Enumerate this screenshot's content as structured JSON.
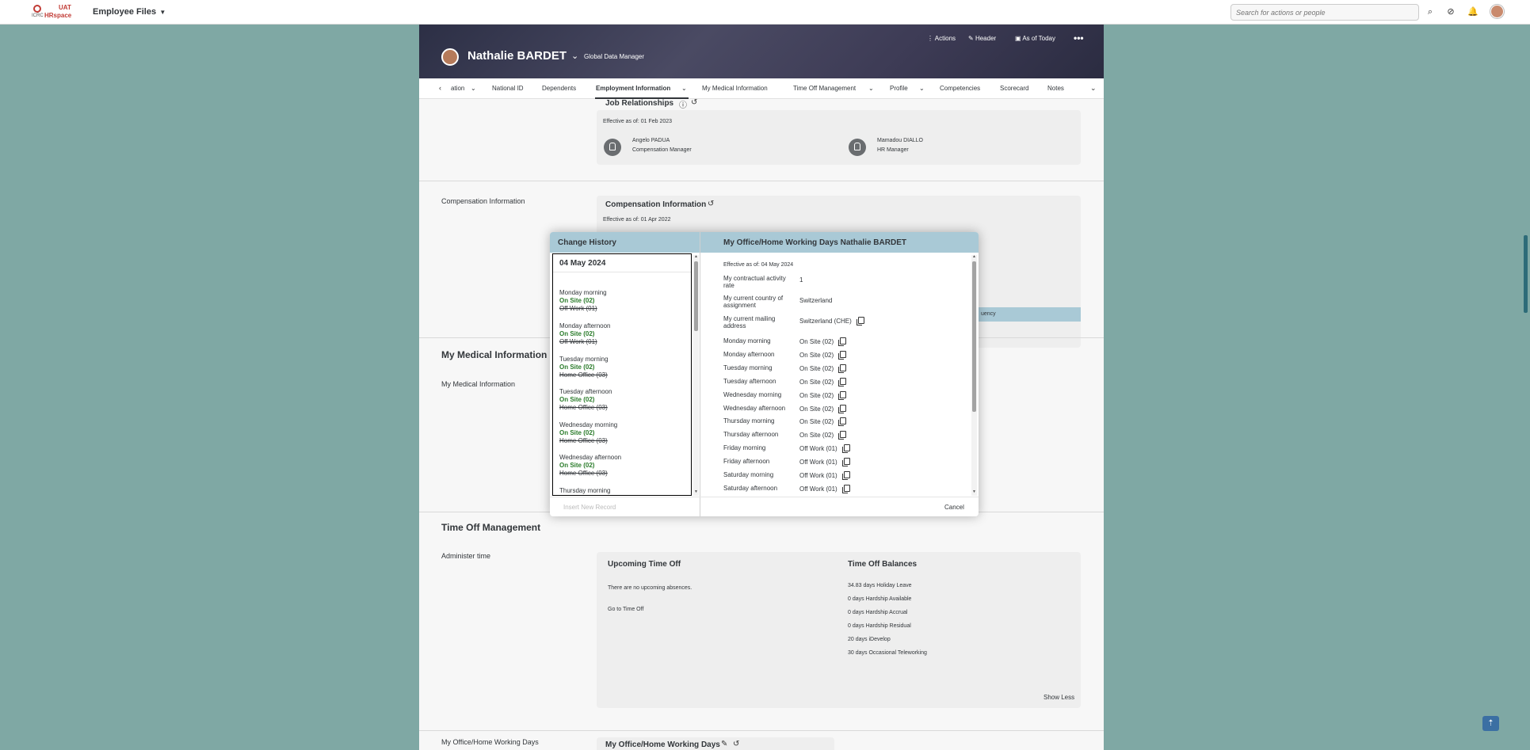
{
  "shell": {
    "logo_env": "UAT",
    "logo_small": "ICRC",
    "logo_app": "HRspace",
    "app_menu": "Employee Files",
    "search_placeholder": "Search for actions or people"
  },
  "header": {
    "name": "Nathalie BARDET",
    "job_title": "Global Data Manager",
    "actions_label": "Actions",
    "header_label": "Header",
    "as_of_label": "As of Today"
  },
  "tabs": [
    "ation",
    "National ID",
    "Dependents",
    "Employment Information",
    "My Medical Information",
    "Time Off Management",
    "Profile",
    "Competencies",
    "Scorecard",
    "Notes"
  ],
  "job_relationships": {
    "section_label": "Job Relationships",
    "card_title": "Job Relationships",
    "effective": "Effective as of: 01 Feb 2023",
    "people": [
      {
        "name": "Angelo PADUA",
        "role": "Compensation Manager"
      },
      {
        "name": "Mamadou DIALLO",
        "role": "HR Manager"
      }
    ]
  },
  "compensation": {
    "section_label": "Compensation Information",
    "card_title": "Compensation Information",
    "effective": "Effective as of: 01 Apr 2022",
    "partial_column": "uency"
  },
  "medical": {
    "section_title": "My Medical Information",
    "section_label": "My Medical Information"
  },
  "time_off": {
    "section_title": "Time Off Management",
    "section_label": "Administer time",
    "upcoming_title": "Upcoming Time Off",
    "no_absences": "There are no upcoming absences.",
    "go_link": "Go to Time Off",
    "balances_title": "Time Off Balances",
    "balances": [
      {
        "amount": "34.83 days",
        "type": "Holiday Leave"
      },
      {
        "amount": "0 days",
        "type": "Hardship Available"
      },
      {
        "amount": "0 days",
        "type": "Hardship Accrual"
      },
      {
        "amount": "0 days",
        "type": "Hardship Residual"
      },
      {
        "amount": "20 days",
        "type": "iDevelop"
      },
      {
        "amount": "30 days",
        "type": "Occasional Teleworking"
      }
    ],
    "show_less": "Show Less"
  },
  "working_days": {
    "section_label": "My Office/Home Working Days",
    "card_title": "My Office/Home Working Days"
  },
  "dialog": {
    "history_title": "Change History",
    "detail_title": "My Office/Home Working Days Nathalie BARDET",
    "history_date": "04 May 2024",
    "history_entries": [
      {
        "label": "Monday morning",
        "new": "On Site (02)",
        "old": "Off Work (01)"
      },
      {
        "label": "Monday afternoon",
        "new": "On Site (02)",
        "old": "Off Work (01)"
      },
      {
        "label": "Tuesday morning",
        "new": "On Site (02)",
        "old": "Home Office (03)"
      },
      {
        "label": "Tuesday afternoon",
        "new": "On Site (02)",
        "old": "Home Office (03)"
      },
      {
        "label": "Wednesday morning",
        "new": "On Site (02)",
        "old": "Home Office (03)"
      },
      {
        "label": "Wednesday afternoon",
        "new": "On Site (02)",
        "old": "Home Office (03)"
      },
      {
        "label": "Thursday morning",
        "new": "",
        "old": ""
      }
    ],
    "effective": "Effective as of: 04 May 2024",
    "fields": [
      {
        "label": "My contractual activity rate",
        "value": "1",
        "copy": false
      },
      {
        "label": "My current country of assignment",
        "value": "Switzerland",
        "copy": false
      },
      {
        "label": "My current mailing address",
        "value": "Switzerland (CHE)",
        "copy": true
      },
      {
        "label": "Monday morning",
        "value": "On Site (02)",
        "copy": true
      },
      {
        "label": "Monday afternoon",
        "value": "On Site (02)",
        "copy": true
      },
      {
        "label": "Tuesday morning",
        "value": "On Site (02)",
        "copy": true
      },
      {
        "label": "Tuesday afternoon",
        "value": "On Site (02)",
        "copy": true
      },
      {
        "label": "Wednesday morning",
        "value": "On Site (02)",
        "copy": true
      },
      {
        "label": "Wednesday afternoon",
        "value": "On Site (02)",
        "copy": true
      },
      {
        "label": "Thursday morning",
        "value": "On Site (02)",
        "copy": true
      },
      {
        "label": "Thursday afternoon",
        "value": "On Site (02)",
        "copy": true
      },
      {
        "label": "Friday morning",
        "value": "Off Work (01)",
        "copy": true
      },
      {
        "label": "Friday afternoon",
        "value": "Off Work (01)",
        "copy": true
      },
      {
        "label": "Saturday morning",
        "value": "Off Work (01)",
        "copy": true
      },
      {
        "label": "Saturday afternoon",
        "value": "Off Work (01)",
        "copy": true
      }
    ],
    "insert_label": "Insert New Record",
    "cancel_label": "Cancel"
  },
  "icons": {
    "search": "search-icon",
    "tasks": "check-circle-icon",
    "bell": "bell-icon",
    "history": "history-icon",
    "copy": "copy-icon",
    "back_to_top": "arrow-up-icon"
  },
  "colors": {
    "backdrop": "#7fa8a4",
    "dialog_header": "#a9c9d6",
    "new_value": "#2b7c2b",
    "back_to_top": "#3b6fa3"
  }
}
